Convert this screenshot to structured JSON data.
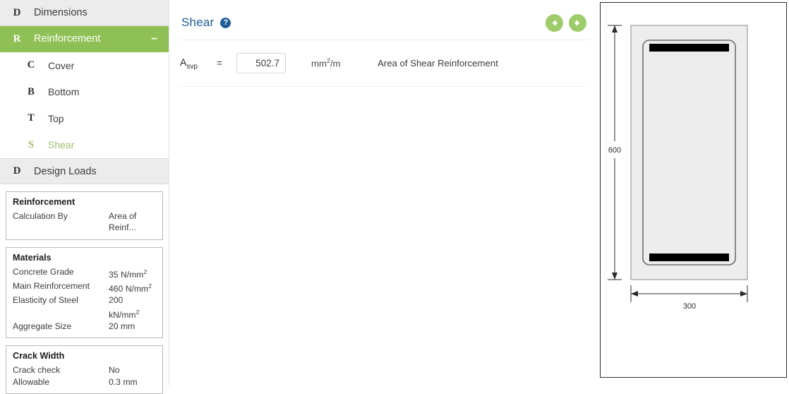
{
  "sidebar": {
    "groups": [
      {
        "letter": "D",
        "label": "Dimensions",
        "active": false,
        "collapse": ""
      },
      {
        "letter": "R",
        "label": "Reinforcement",
        "active": true,
        "collapse": "−"
      }
    ],
    "sub_items": [
      {
        "letter": "C",
        "label": "Cover",
        "selected": false
      },
      {
        "letter": "B",
        "label": "Bottom",
        "selected": false
      },
      {
        "letter": "T",
        "label": "Top",
        "selected": false
      },
      {
        "letter": "S",
        "label": "Shear",
        "selected": true
      }
    ],
    "design_loads": {
      "letter": "D",
      "label": "Design Loads"
    },
    "panels": [
      {
        "title": "Reinforcement",
        "rows": [
          {
            "key": "Calculation By",
            "value": "Area of Reinf..."
          }
        ]
      },
      {
        "title": "Materials",
        "rows": [
          {
            "key": "Concrete Grade",
            "value": "35 N/mm",
            "sup": "2"
          },
          {
            "key": "Main Reinforcement",
            "value": "460 N/mm",
            "sup": "2"
          },
          {
            "key": "Elasticity of Steel",
            "value": "200 kN/mm",
            "sup": "2"
          },
          {
            "key": "Aggregate Size",
            "value": "20 mm",
            "sup": ""
          }
        ]
      },
      {
        "title": "Crack Width",
        "rows": [
          {
            "key": "Crack check",
            "value": "No",
            "sup": ""
          },
          {
            "key": "Allowable",
            "value": "0.3 mm",
            "sup": ""
          }
        ]
      }
    ]
  },
  "main": {
    "title": "Shear",
    "help_icon": "question-mark-icon",
    "back_label": "back-arrow-icon",
    "forward_label": "forward-arrow-icon",
    "field": {
      "symbol_base": "A",
      "symbol_sub": "svp",
      "equals": "=",
      "value": "502.7",
      "placeholder": "0",
      "units_base": "mm",
      "units_sup": "2",
      "units_suffix": "/m",
      "description": "Area of Shear Reinforcement"
    }
  },
  "diagram": {
    "height_label": "600",
    "width_label": "300",
    "colors": {
      "concrete_fill": "#ededed",
      "rebar": "#000000",
      "outline": "#8a8a8a"
    }
  },
  "colors": {
    "accent_green": "#8fc055",
    "title_blue": "#1f5c99",
    "sidebar_head": "#ececec"
  }
}
